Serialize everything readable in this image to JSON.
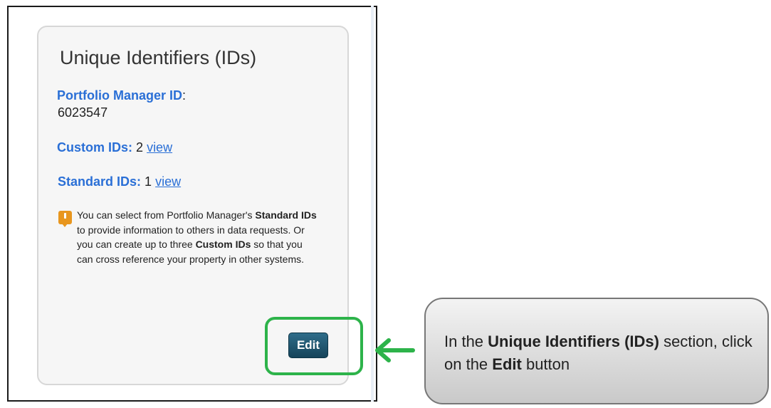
{
  "card": {
    "title": "Unique Identifiers (IDs)",
    "pm_id_label": "Portfolio Manager ID",
    "pm_id_colon": ":",
    "pm_id_value": "6023547",
    "custom_ids_label": "Custom IDs:",
    "custom_ids_count": "2",
    "custom_ids_link": "view",
    "standard_ids_label": "Standard IDs:",
    "standard_ids_count": "1",
    "standard_ids_link": "view",
    "info": {
      "t1": "You can select from Portfolio Manager's ",
      "b1": "Standard IDs",
      "t2": " to provide information to others in data requests. Or you can create up to three ",
      "b2": "Custom IDs",
      "t3": " so that you can cross reference your property in other systems."
    },
    "edit_button": "Edit"
  },
  "callout": {
    "t1": "In the ",
    "b1": "Unique Identifiers (IDs)",
    "t2": " section, click on the ",
    "b2": "Edit",
    "t3": " button"
  },
  "colors": {
    "highlight": "#2db34a",
    "link": "#2a6fd6",
    "edit_button": "#1e5670",
    "info_icon": "#e8961e"
  },
  "icons": {
    "info": "info-icon",
    "arrow": "left-arrow-icon"
  }
}
